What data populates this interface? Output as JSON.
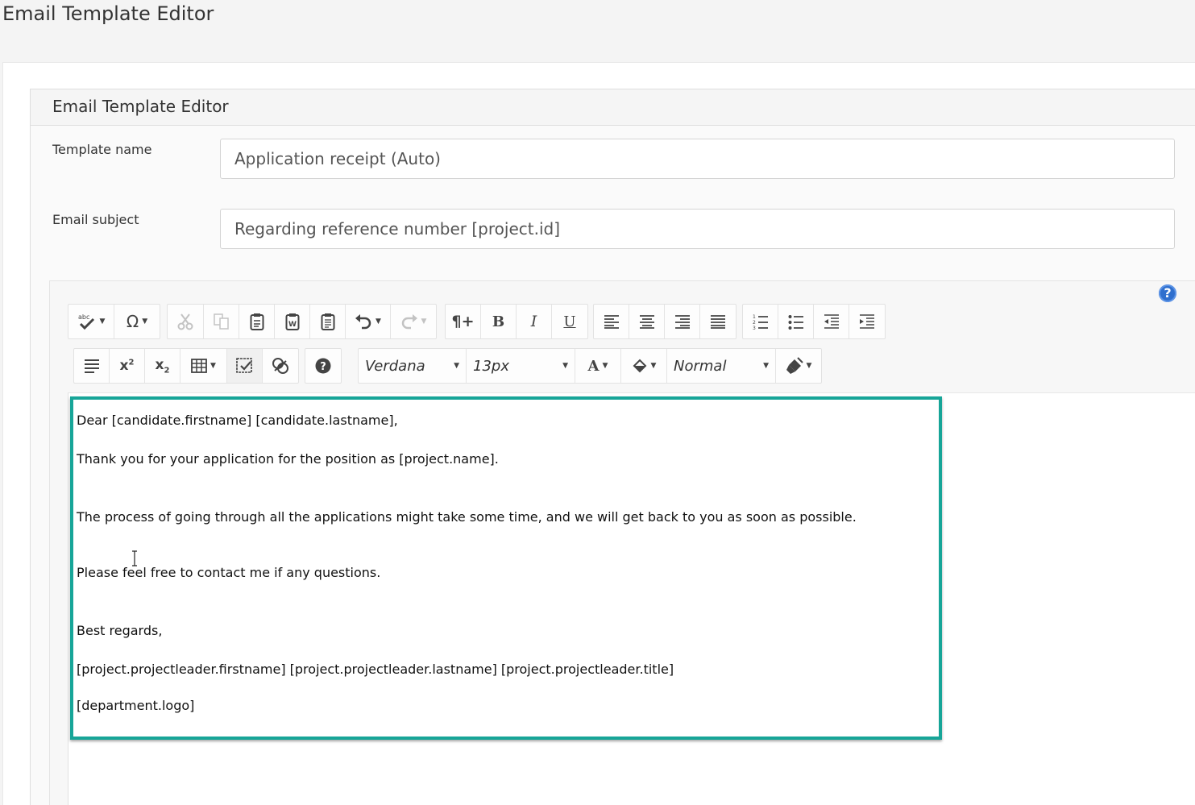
{
  "page": {
    "title": "Email Template Editor"
  },
  "card": {
    "title": "Email Template Editor"
  },
  "form": {
    "template_name": {
      "label": "Template name",
      "value": "Application receipt (Auto)"
    },
    "email_subject": {
      "label": "Email subject",
      "value": "Regarding reference number [project.id]"
    }
  },
  "editor": {
    "help_label": "?",
    "toolbar": {
      "font_family": "Verdana",
      "font_size": "13px",
      "format": "Normal",
      "row1_groups": [
        [
          "spellcheck",
          "special-character"
        ],
        [
          "cut",
          "copy",
          "paste",
          "paste-from-word",
          "paste-plain-text",
          "undo",
          "redo"
        ],
        [
          "paragraph",
          "bold",
          "italic",
          "underline"
        ],
        [
          "align-left",
          "align-center",
          "align-right",
          "justify"
        ],
        [
          "ordered-list",
          "unordered-list",
          "outdent",
          "indent"
        ]
      ],
      "row2_groups": [
        [
          "line-height",
          "superscript",
          "subscript",
          "table",
          "select-all",
          "cleanup"
        ],
        [
          "help"
        ],
        [
          "font-family",
          "font-size",
          "font-color",
          "background-color",
          "paragraph-format",
          "clear-formatting"
        ]
      ]
    },
    "body_lines": [
      "Dear [candidate.firstname] [candidate.lastname],",
      "Thank you for your application for the position as [project.name].",
      "The process of going through all the applications might take some time, and we will get back to you as soon as possible.",
      "Please feel free to contact me if any questions.",
      "Best regards,",
      "[project.projectleader.firstname] [project.projectleader.lastname] [project.projectleader.title]",
      "[department.logo]"
    ],
    "highlight_color": "#17a598",
    "accent_color": "#2f6fce"
  }
}
